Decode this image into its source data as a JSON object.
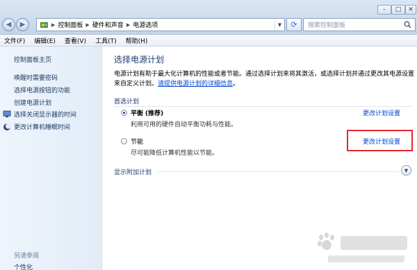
{
  "window": {
    "controls": {
      "minimize": "–",
      "maximize": "□",
      "close": "✕"
    }
  },
  "address": {
    "crumbs": [
      "控制面板",
      "硬件和声音",
      "电源选项"
    ],
    "search_placeholder": "搜索控制面板"
  },
  "menu": [
    "文件(F)",
    "编辑(E)",
    "查看(V)",
    "工具(T)",
    "帮助(H)"
  ],
  "left_pane": {
    "home": "控制面板主页",
    "links": [
      "唤醒时需要密码",
      "选择电源按钮的功能",
      "创建电源计划"
    ],
    "icon_links": [
      "选择关闭显示器的时间",
      "更改计算机睡眠时间"
    ],
    "see_also": "另请参阅",
    "personalize": "个性化"
  },
  "main": {
    "title": "选择电源计划",
    "desc_line1": "电源计划有助于最大化计算机的性能或者节能。通过选择计划来将其激活，或选择计划并通过更改其电源设置",
    "desc_line2_prefix": "来自定义计划。",
    "desc_link": "请提供电源计划的详细信息",
    "desc_suffix": "。",
    "preferred_plans": "首选计划",
    "plans": [
      {
        "name": "平衡",
        "tag": "(推荐)",
        "desc": "利用可用的硬件自动平衡功耗与性能。",
        "link": "更改计划设置",
        "selected": true
      },
      {
        "name": "节能",
        "tag": "",
        "desc": "尽可能降低计算机性能以节能。",
        "link": "更改计划设置",
        "selected": false
      }
    ],
    "show_additional": "显示附加计划"
  },
  "colors": {
    "highlight": "#e3262b",
    "link": "#0044cc",
    "heading": "#1e3d70"
  },
  "icons": {
    "back": "back-arrow-icon",
    "forward": "forward-arrow-icon",
    "refresh": "refresh-icon",
    "search": "search-icon",
    "address": "control-panel-icon",
    "monitor": "monitor-icon",
    "moon": "sleep-icon",
    "expand": "chevron-down-icon"
  }
}
